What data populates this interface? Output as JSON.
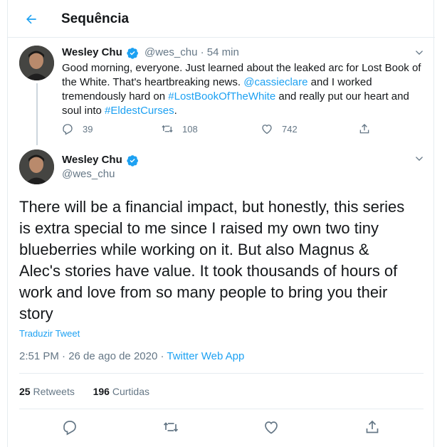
{
  "header": {
    "title": "Sequência"
  },
  "reply_tweet": {
    "name": "Wesley Chu",
    "handle": "@wes_chu",
    "separator": "·",
    "time": "54 min",
    "lines": [
      [
        "Good morning, everyone. Just learned about the leaked arc for Lost Book of"
      ],
      [
        "the White. That's heartbreaking news. ",
        "@cassieclare",
        " and I worked"
      ],
      [
        "tremendously hard on ",
        "#LostBookOfTheWhite",
        " and really put our heart and"
      ],
      [
        "soul into ",
        "#EldestCurses",
        "."
      ]
    ],
    "replies": "39",
    "retweets": "108",
    "likes": "742"
  },
  "main_tweet": {
    "name": "Wesley Chu",
    "handle": "@wes_chu",
    "lines": [
      "There will be a financial impact, but honestly, this series",
      "is extra special to me since I raised my own two tiny",
      "blueberries while working on it. But also Magnus &",
      "Alec's stories have value. It took thousands of hours of",
      "work and love from so many people to bring you their",
      "story"
    ],
    "translate": "Traduzir Tweet",
    "timestamp": "2:51 PM · 26 de ago de 2020 · ",
    "app": "Twitter Web App",
    "retweets_count": "25",
    "retweets_label": "Retweets",
    "likes_count": "196",
    "likes_label": "Curtidas"
  },
  "colors": {
    "accent": "#1da1f2",
    "muted": "#657786",
    "text": "#14171a",
    "border": "#e6ecf0"
  },
  "icons": [
    "back-arrow-icon",
    "verified-badge-icon",
    "chevron-down-icon",
    "reply-icon",
    "retweet-icon",
    "like-icon",
    "share-icon"
  ]
}
